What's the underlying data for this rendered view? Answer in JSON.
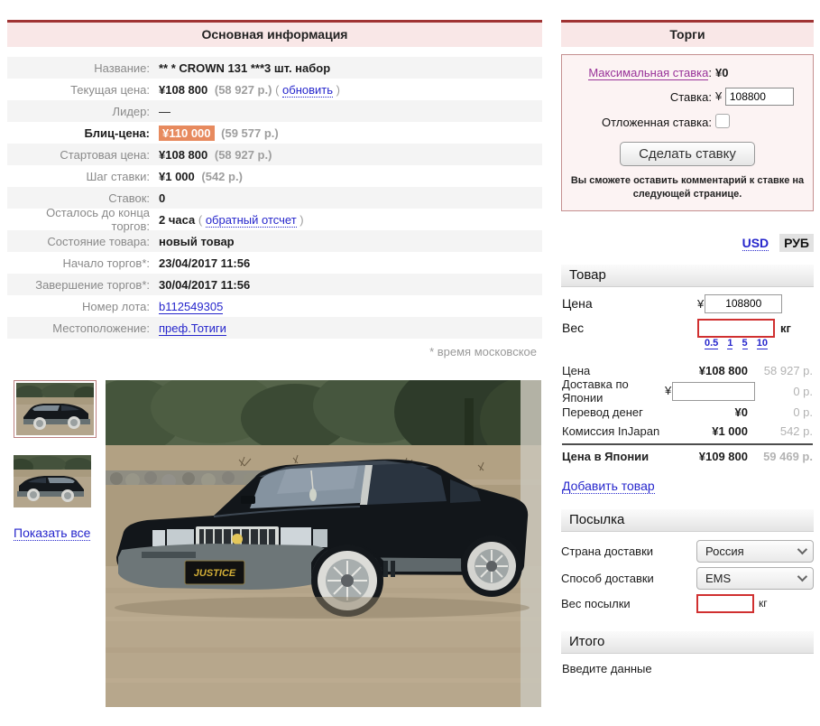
{
  "main_info": {
    "title": "Основная информация",
    "time_note": "* время московское",
    "rows": [
      {
        "label": "Название:",
        "value": "** * CROWN 131 ***3 шт. набор"
      },
      {
        "label": "Текущая цена:",
        "value": "¥108 800",
        "secondary": "(58 927 р.)",
        "link_pre": "( ",
        "link": "обновить",
        "link_post": " )"
      },
      {
        "label": "Лидер:",
        "value": "—"
      },
      {
        "label": "Блиц-цена:",
        "value": "¥110 000",
        "secondary": "(59 577 р.)"
      },
      {
        "label": "Стартовая цена:",
        "value": "¥108 800",
        "secondary": "(58 927 р.)"
      },
      {
        "label": "Шаг ставки:",
        "value": "¥1 000",
        "secondary": "(542 р.)"
      },
      {
        "label": "Ставок:",
        "value": "0"
      },
      {
        "label": "Осталось до конца торгов:",
        "value": "2 часа",
        "link_pre": "( ",
        "link": "обратный отсчет",
        "link_post": " )"
      },
      {
        "label": "Состояние товара:",
        "value": "новый товар"
      },
      {
        "label": "Начало торгов*:",
        "value": "23/04/2017 11:56"
      },
      {
        "label": "Завершение торгов*:",
        "value": "30/04/2017 11:56"
      },
      {
        "label": "Номер лота:",
        "link": "b112549305"
      },
      {
        "label": "Местоположение:",
        "link": "преф.Тотиги"
      }
    ]
  },
  "gallery": {
    "show_all": "Показать все",
    "plate_text": "JUSTICE"
  },
  "bids": {
    "title": "Торги",
    "max_bid_label": "Максимальная ставка",
    "colon": ":",
    "max_bid_value": "¥0",
    "bid_label": "Ставка:",
    "currency_sign": "¥",
    "bid_input_value": "108800",
    "deferred_label": "Отложенная ставка:",
    "submit_label": "Сделать ставку",
    "note": "Вы сможете оставить комментарий к ставке на следующей странице."
  },
  "currency_tabs": {
    "usd": "USD",
    "rub": "РУБ"
  },
  "product": {
    "title": "Товар",
    "price_label": "Цена",
    "currency_sign": "¥",
    "price_value": "108800",
    "weight_label": "Вес",
    "weight_unit": "кг",
    "weight_presets": [
      "0.5",
      "1",
      "5",
      "10"
    ],
    "breakdown": [
      {
        "label": "Цена",
        "yen": "¥108 800",
        "rub": "58 927 р."
      },
      {
        "label": "Доставка по Японии",
        "yen": "",
        "rub": "0 р."
      },
      {
        "label": "Перевод денег",
        "yen": "¥0",
        "rub": "0 р."
      },
      {
        "label": "Комиссия InJapan",
        "yen": "¥1 000",
        "rub": "542 р."
      }
    ],
    "total": {
      "label": "Цена в Японии",
      "yen": "¥109 800",
      "rub": "59 469 р."
    },
    "add_link": "Добавить товар"
  },
  "parcel": {
    "title": "Посылка",
    "country_label": "Страна доставки",
    "country_value": "Россия",
    "method_label": "Способ доставки",
    "method_value": "EMS",
    "weight_label": "Вес посылки",
    "weight_unit": "кг"
  },
  "total_section": {
    "title": "Итого",
    "message": "Введите данные"
  },
  "colors": {
    "header_bg": "#f9e7e7",
    "header_border": "#a03333",
    "highlight_orange": "#e78a5e",
    "link_blue": "#2626cc",
    "link_purple": "#993399",
    "alert_red": "#d03030"
  }
}
